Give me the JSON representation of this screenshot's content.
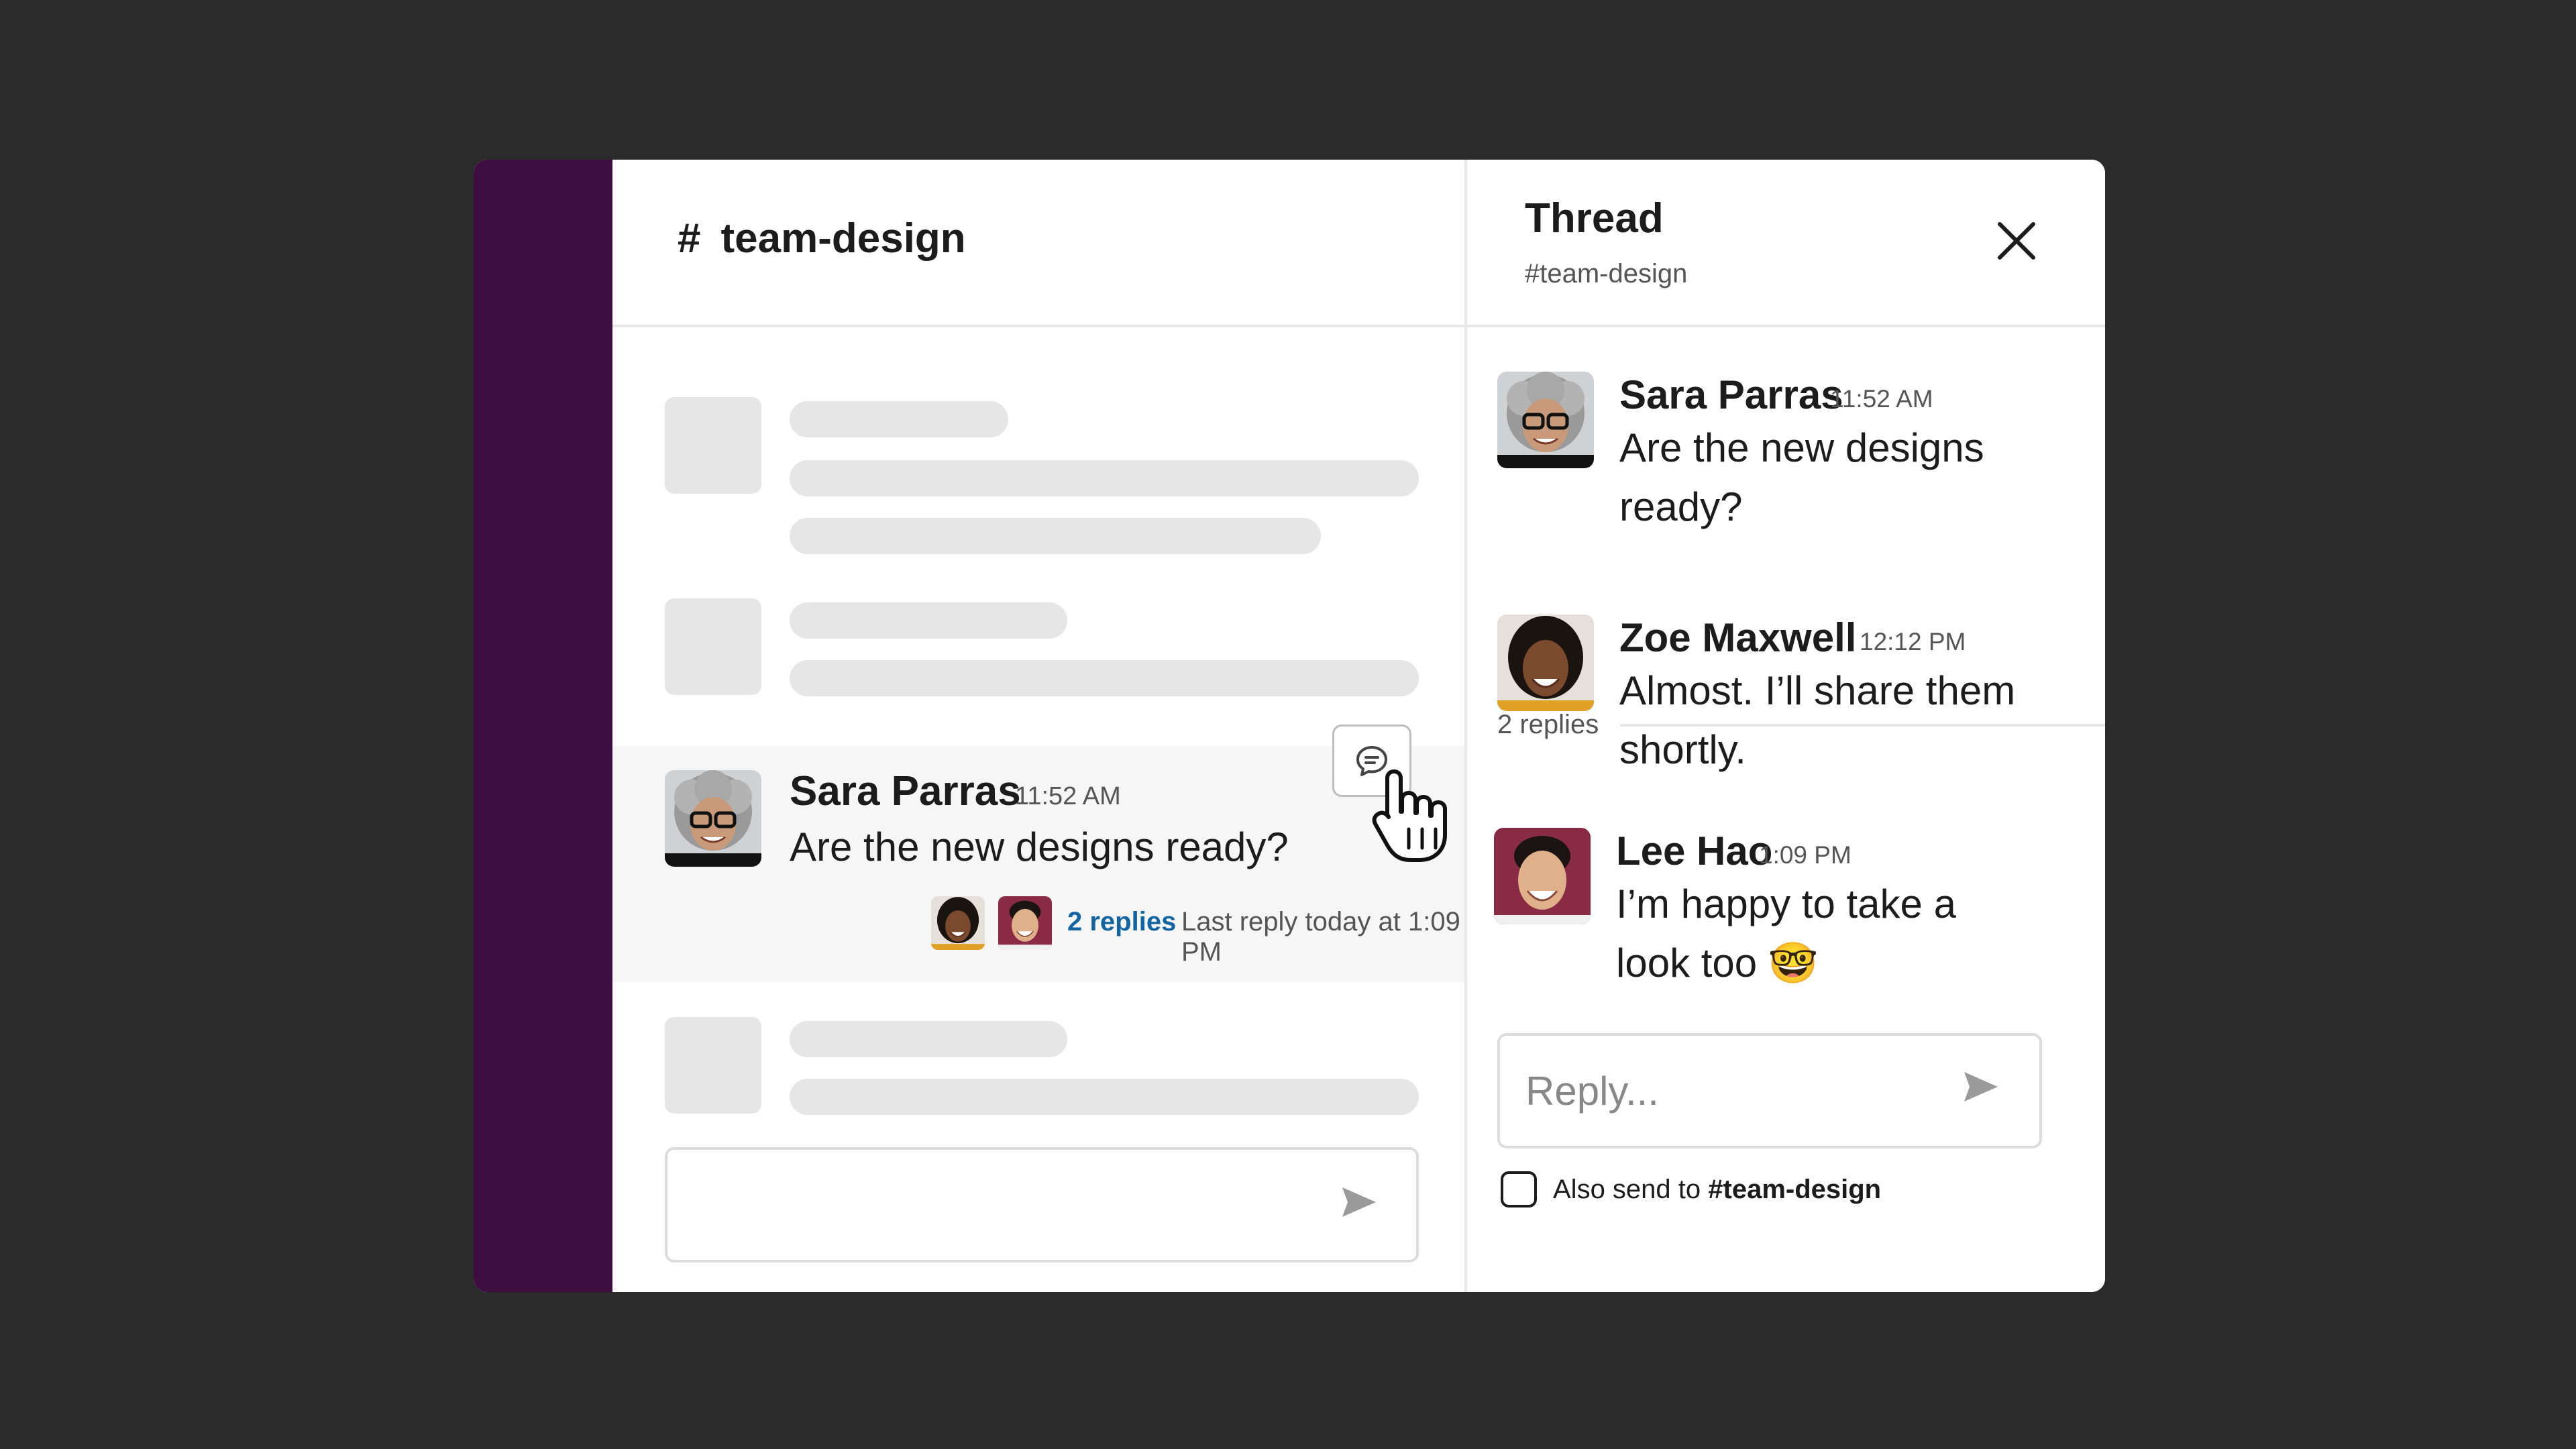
{
  "channel": {
    "hash": "#",
    "name": "team-design"
  },
  "main_message": {
    "author": "Sara Parras",
    "time": "11:52 AM",
    "text": "Are the new designs ready?",
    "replies_link": "2 replies",
    "last_reply": "Last reply today at 1:09 PM"
  },
  "thread": {
    "title": "Thread",
    "subtitle": "#team-design",
    "replies_label": "2 replies",
    "messages": [
      {
        "author": "Sara Parras",
        "time": "11:52 AM",
        "text": "Are the new designs ready?"
      },
      {
        "author": "Zoe Maxwell",
        "time": "12:12 PM",
        "text": "Almost. I’ll share them shortly."
      },
      {
        "author": "Lee Hao",
        "time": "1:09 PM",
        "text": "I’m happy to take a look too 🤓"
      }
    ],
    "reply_placeholder": "Reply...",
    "also_send_prefix": "Also send to",
    "also_send_channel": "#team-design"
  },
  "colors": {
    "background": "#2b2b2c",
    "sidebar": "#3f0e40",
    "link": "#1264a3",
    "skeleton": "#e6e6e6"
  },
  "icons": [
    "thread-reply-icon",
    "send-icon",
    "close-icon",
    "pointer-cursor-icon"
  ]
}
